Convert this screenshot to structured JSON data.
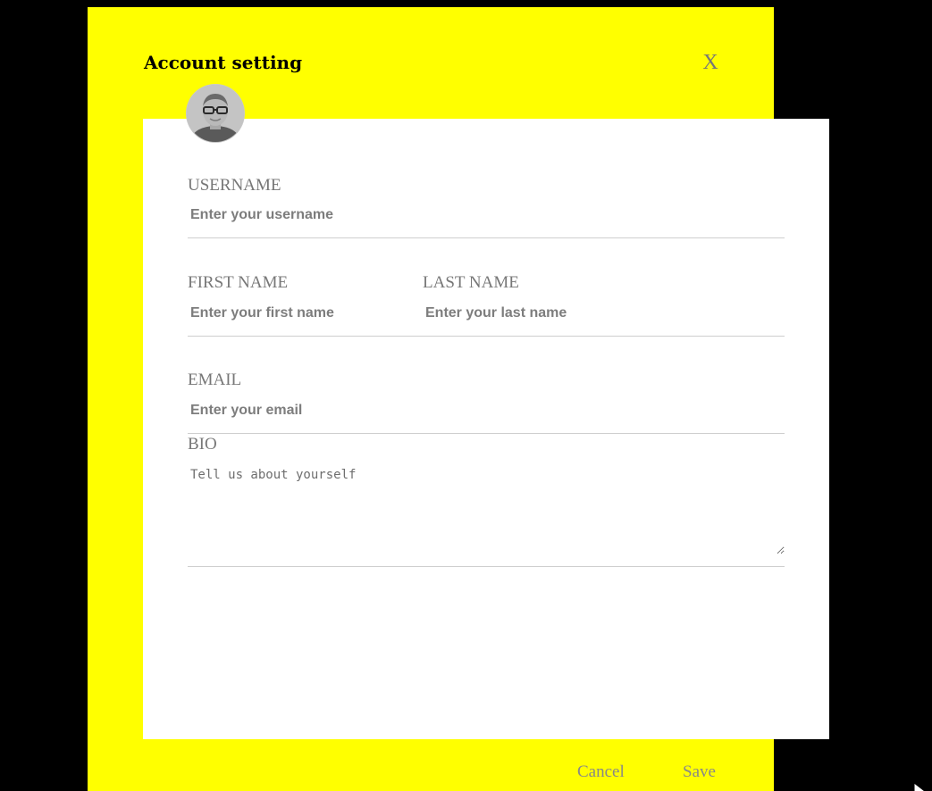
{
  "modal": {
    "title": "Account setting",
    "close_label": "X"
  },
  "avatar": {
    "alt": "User profile photo"
  },
  "form": {
    "username": {
      "label": "USERNAME",
      "placeholder": "Enter your username",
      "value": ""
    },
    "first_name": {
      "label": "FIRST NAME",
      "placeholder": "Enter your first name",
      "value": ""
    },
    "last_name": {
      "label": "LAST NAME",
      "placeholder": "Enter your last name",
      "value": ""
    },
    "email": {
      "label": "EMAIL",
      "placeholder": "Enter your email",
      "value": ""
    },
    "bio": {
      "label": "BIO",
      "placeholder": "Tell us about yourself",
      "value": ""
    }
  },
  "footer": {
    "cancel_label": "Cancel",
    "save_label": "Save"
  },
  "icons": {
    "close": "close-icon",
    "cursor": "mouse-pointer-icon",
    "resize": "resize-handle-icon"
  },
  "colors": {
    "page_background": "#000000",
    "modal_background": "#ffff00",
    "card_background": "#ffffff",
    "label_color": "#777777",
    "button_text_color": "#888888",
    "divider_color": "#cfcfcf"
  }
}
